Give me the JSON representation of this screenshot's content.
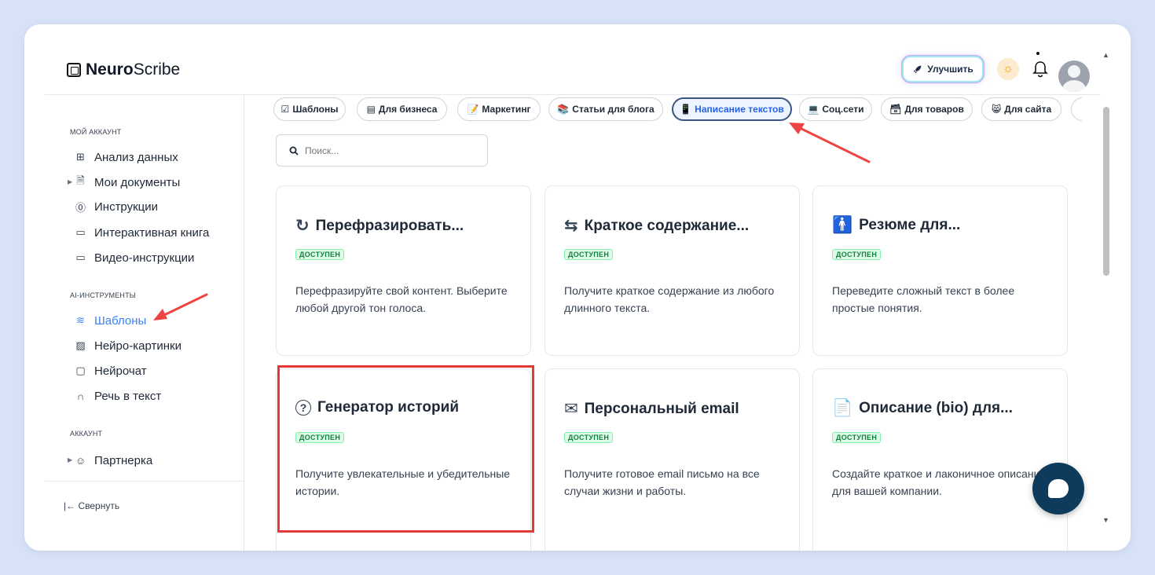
{
  "app": {
    "logo_bold": "Neuro",
    "logo_rest": "Scribe"
  },
  "header": {
    "upgrade_label": "Улучшить",
    "icons": [
      "rocket-icon",
      "sun-icon",
      "bell-icon",
      "avatar"
    ]
  },
  "sidebar": {
    "section1": "МОЙ АККАУНТ",
    "items1": [
      {
        "label": "Анализ данных",
        "icon": "grid-icon"
      },
      {
        "label": "Мои документы",
        "icon": "document-icon"
      },
      {
        "label": "Инструкции",
        "icon": "help-icon"
      },
      {
        "label": "Интерактивная книга",
        "icon": "book-icon"
      },
      {
        "label": "Видео-инструкции",
        "icon": "video-icon"
      }
    ],
    "section2": "AI-ИНСТРУМЕНТЫ",
    "items2": [
      {
        "label": "Шаблоны",
        "icon": "layers-icon",
        "active": true
      },
      {
        "label": "Нейро-картинки",
        "icon": "image-icon"
      },
      {
        "label": "Нейрочат",
        "icon": "chat-icon"
      },
      {
        "label": "Речь в текст",
        "icon": "headphones-icon"
      }
    ],
    "section3": "АККАУНТ",
    "items3": [
      {
        "label": "Партнерка",
        "icon": "users-icon"
      }
    ],
    "collapse_label": "|← Свернуть"
  },
  "categories": [
    {
      "emoji": "☑",
      "label": "Шаблоны"
    },
    {
      "emoji": "▤",
      "label": "Для бизнеса"
    },
    {
      "emoji": "📝",
      "label": "Маркетинг"
    },
    {
      "emoji": "📚",
      "label": "Статьи для блога"
    },
    {
      "emoji": "📱",
      "label": "Написание текстов",
      "active": true
    },
    {
      "emoji": "💻",
      "label": "Соц.сети"
    },
    {
      "emoji": "🗃",
      "label": "Для товаров"
    },
    {
      "emoji": "😸",
      "label": "Для сайта"
    }
  ],
  "search": {
    "placeholder": "Поиск..."
  },
  "cards": [
    {
      "icon": "↻",
      "title": "Перефразировать...",
      "badge": "ДОСТУПЕН",
      "desc": "Перефразируйте свой контент. Выберите любой другой тон голоса."
    },
    {
      "icon": "⇆",
      "title": "Краткое содержание...",
      "badge": "ДОСТУПЕН",
      "desc": "Получите краткое содержание из любого длинного текста."
    },
    {
      "icon": "🚹",
      "title": "Резюме для...",
      "badge": "ДОСТУПЕН",
      "desc": "Переведите сложный текст в более простые понятия."
    },
    {
      "icon": "?",
      "title": "Генератор историй",
      "badge": "ДОСТУПЕН",
      "desc": "Получите увлекательные и убедительные истории."
    },
    {
      "icon": "✉",
      "title": "Персональный email",
      "badge": "ДОСТУПЕН",
      "desc": "Получите готовое email письмо на все случаи жизни и работы."
    },
    {
      "icon": "📄",
      "title": "Описание (bio) для...",
      "badge": "ДОСТУПЕН",
      "desc": "Создайте краткое и лаконичное описание для вашей компании."
    }
  ],
  "colors": {
    "accent": "#3b82f6",
    "badge_green": "#15803d",
    "highlight_red": "#e53935",
    "chat_button": "#0e3a5c"
  }
}
